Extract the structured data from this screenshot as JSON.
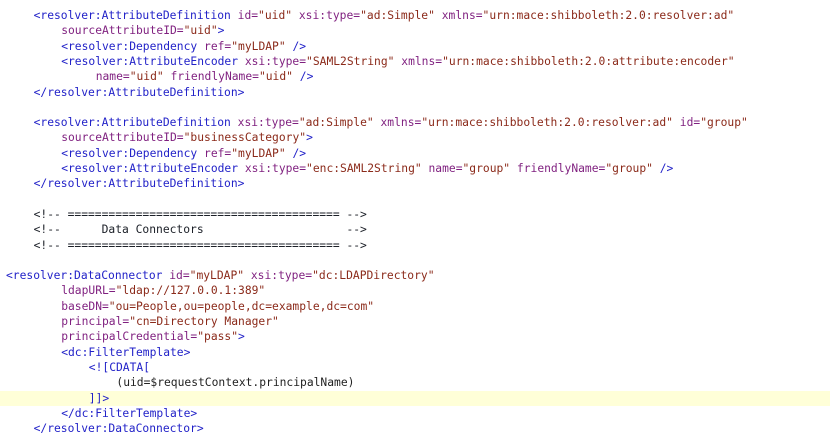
{
  "editor": {
    "highlight_color": "#ffffd8",
    "colors": {
      "tag": "#2222c8",
      "attribute": "#7f1f7f",
      "value": "#8b2a1a",
      "comment": "#1b1f27",
      "text": "#222222"
    },
    "lines": [
      {
        "indent": 4,
        "tokens": [
          [
            "t",
            "<resolver:AttributeDefinition "
          ],
          [
            "a",
            "id="
          ],
          [
            "v",
            "\"uid\""
          ],
          [
            "p",
            " "
          ],
          [
            "a",
            "xsi:type="
          ],
          [
            "v",
            "\"ad:Simple\""
          ],
          [
            "p",
            " "
          ],
          [
            "a",
            "xmlns="
          ],
          [
            "v",
            "\"urn:mace:shibboleth:2.0:resolver:ad\""
          ]
        ]
      },
      {
        "indent": 8,
        "tokens": [
          [
            "a",
            "sourceAttributeID="
          ],
          [
            "v",
            "\"uid\""
          ],
          [
            "t",
            ">"
          ]
        ]
      },
      {
        "indent": 8,
        "tokens": [
          [
            "t",
            "<resolver:Dependency "
          ],
          [
            "a",
            "ref="
          ],
          [
            "v",
            "\"myLDAP\""
          ],
          [
            "t",
            " />"
          ]
        ]
      },
      {
        "indent": 8,
        "tokens": [
          [
            "t",
            "<resolver:AttributeEncoder "
          ],
          [
            "a",
            "xsi:type="
          ],
          [
            "v",
            "\"SAML2String\""
          ],
          [
            "p",
            " "
          ],
          [
            "a",
            "xmlns="
          ],
          [
            "v",
            "\"urn:mace:shibboleth:2.0:attribute:encoder\""
          ]
        ]
      },
      {
        "indent": 13,
        "tokens": [
          [
            "a",
            "name="
          ],
          [
            "v",
            "\"uid\""
          ],
          [
            "p",
            " "
          ],
          [
            "a",
            "friendlyName="
          ],
          [
            "v",
            "\"uid\""
          ],
          [
            "t",
            " />"
          ]
        ]
      },
      {
        "indent": 4,
        "tokens": [
          [
            "t",
            "</resolver:AttributeDefinition>"
          ]
        ]
      },
      {
        "indent": 0,
        "tokens": []
      },
      {
        "indent": 4,
        "tokens": [
          [
            "t",
            "<resolver:AttributeDefinition "
          ],
          [
            "a",
            "xsi:type="
          ],
          [
            "v",
            "\"ad:Simple\""
          ],
          [
            "p",
            " "
          ],
          [
            "a",
            "xmlns="
          ],
          [
            "v",
            "\"urn:mace:shibboleth:2.0:resolver:ad\""
          ],
          [
            "p",
            " "
          ],
          [
            "a",
            "id="
          ],
          [
            "v",
            "\"group\""
          ]
        ]
      },
      {
        "indent": 8,
        "tokens": [
          [
            "a",
            "sourceAttributeID="
          ],
          [
            "v",
            "\"businessCategory\""
          ],
          [
            "t",
            ">"
          ]
        ]
      },
      {
        "indent": 8,
        "tokens": [
          [
            "t",
            "<resolver:Dependency "
          ],
          [
            "a",
            "ref="
          ],
          [
            "v",
            "\"myLDAP\""
          ],
          [
            "t",
            " />"
          ]
        ]
      },
      {
        "indent": 8,
        "tokens": [
          [
            "t",
            "<resolver:AttributeEncoder "
          ],
          [
            "a",
            "xsi:type="
          ],
          [
            "v",
            "\"enc:SAML2String\""
          ],
          [
            "p",
            " "
          ],
          [
            "a",
            "name="
          ],
          [
            "v",
            "\"group\""
          ],
          [
            "p",
            " "
          ],
          [
            "a",
            "friendlyName="
          ],
          [
            "v",
            "\"group\""
          ],
          [
            "t",
            " />"
          ]
        ]
      },
      {
        "indent": 4,
        "tokens": [
          [
            "t",
            "</resolver:AttributeDefinition>"
          ]
        ]
      },
      {
        "indent": 0,
        "tokens": []
      },
      {
        "indent": 4,
        "tokens": [
          [
            "c",
            "<!-- ======================================== -->"
          ]
        ]
      },
      {
        "indent": 4,
        "tokens": [
          [
            "c",
            "<!--      Data Connectors                     -->"
          ]
        ]
      },
      {
        "indent": 4,
        "tokens": [
          [
            "c",
            "<!-- ======================================== -->"
          ]
        ]
      },
      {
        "indent": 0,
        "tokens": []
      },
      {
        "indent": 0,
        "tokens": [
          [
            "t",
            "<resolver:DataConnector "
          ],
          [
            "a",
            "id="
          ],
          [
            "v",
            "\"myLDAP\""
          ],
          [
            "p",
            " "
          ],
          [
            "a",
            "xsi:type="
          ],
          [
            "v",
            "\"dc:LDAPDirectory\""
          ]
        ]
      },
      {
        "indent": 8,
        "tokens": [
          [
            "a",
            "ldapURL="
          ],
          [
            "v",
            "\"ldap://127.0.0.1:389\""
          ]
        ]
      },
      {
        "indent": 8,
        "tokens": [
          [
            "a",
            "baseDN="
          ],
          [
            "v",
            "\"ou=People,ou=people,dc=example,dc=com\""
          ]
        ]
      },
      {
        "indent": 8,
        "tokens": [
          [
            "a",
            "principal="
          ],
          [
            "v",
            "\"cn=Directory Manager\""
          ]
        ]
      },
      {
        "indent": 8,
        "tokens": [
          [
            "a",
            "principalCredential="
          ],
          [
            "v",
            "\"pass\""
          ],
          [
            "t",
            ">"
          ]
        ]
      },
      {
        "indent": 8,
        "tokens": [
          [
            "t",
            "<dc:FilterTemplate>"
          ]
        ]
      },
      {
        "indent": 12,
        "tokens": [
          [
            "t",
            "<![CDATA["
          ]
        ]
      },
      {
        "indent": 16,
        "tokens": [
          [
            "p",
            "(uid=$requestContext.principalName)"
          ]
        ]
      },
      {
        "indent": 12,
        "highlight": true,
        "tokens": [
          [
            "t",
            "]]>"
          ]
        ]
      },
      {
        "indent": 8,
        "tokens": [
          [
            "t",
            "</dc:FilterTemplate>"
          ]
        ]
      },
      {
        "indent": 4,
        "tokens": [
          [
            "t",
            "</resolver:DataConnector>"
          ]
        ]
      }
    ]
  }
}
